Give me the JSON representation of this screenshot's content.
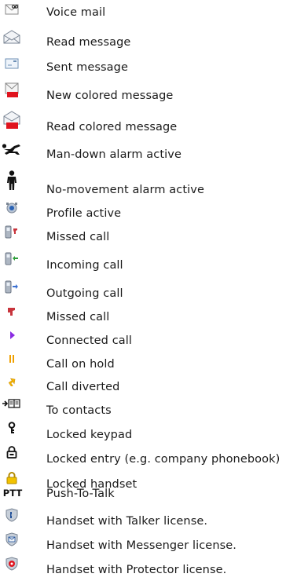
{
  "icon_legend": [
    {
      "icon": "voice-mail-icon",
      "label": "Voice mail"
    },
    {
      "icon": "read-message-icon",
      "label": "Read message"
    },
    {
      "icon": "sent-message-icon",
      "label": "Sent message"
    },
    {
      "icon": "new-colored-message-icon",
      "label": "New colored message"
    },
    {
      "icon": "read-colored-message-icon",
      "label": "Read colored message"
    },
    {
      "icon": "man-down-alarm-icon",
      "label": "Man-down alarm active"
    },
    {
      "icon": "no-movement-alarm-icon",
      "label": "No-movement alarm active"
    },
    {
      "icon": "profile-active-icon",
      "label": "Profile active"
    },
    {
      "icon": "missed-call-handset-icon",
      "label": "Missed call"
    },
    {
      "icon": "incoming-call-icon",
      "label": "Incoming call"
    },
    {
      "icon": "outgoing-call-icon",
      "label": "Outgoing call"
    },
    {
      "icon": "missed-call-icon",
      "label": "Missed call"
    },
    {
      "icon": "connected-call-icon",
      "label": "Connected call"
    },
    {
      "icon": "call-on-hold-icon",
      "label": "Call on hold"
    },
    {
      "icon": "call-diverted-icon",
      "label": "Call diverted"
    },
    {
      "icon": "to-contacts-icon",
      "label": "To contacts"
    },
    {
      "icon": "locked-keypad-icon",
      "label": "Locked keypad"
    },
    {
      "icon": "locked-entry-icon",
      "label": "Locked entry  (e.g. company phonebook)"
    },
    {
      "icon": "locked-handset-icon",
      "label": "Locked handset"
    },
    {
      "icon": "push-to-talk-icon",
      "label": "Push-To-Talk",
      "icon_text": "PTT"
    },
    {
      "icon": "talker-license-icon",
      "label": "Handset with Talker license."
    },
    {
      "icon": "messenger-license-icon",
      "label": "Handset with Messenger license."
    },
    {
      "icon": "protector-license-icon",
      "label": "Handset with Protector license."
    }
  ],
  "colors": {
    "alarm_red": "#e0141e",
    "call_red": "#c8343c",
    "connected_purple": "#8a2be2",
    "hold_orange": "#f0a000",
    "diverted_yellow": "#f5b400",
    "incoming_green": "#2e9e3a",
    "outgoing_blue": "#3a6fd0",
    "lock_gold": "#f2c200"
  }
}
